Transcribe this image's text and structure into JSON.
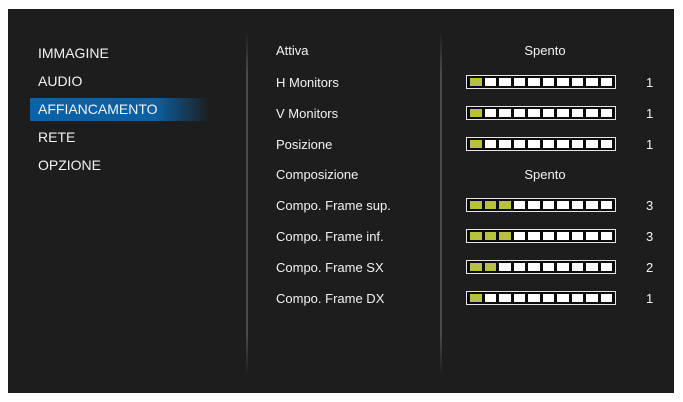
{
  "menu": {
    "items": [
      {
        "label": "IMMAGINE",
        "selected": false
      },
      {
        "label": "AUDIO",
        "selected": false
      },
      {
        "label": "AFFIANCAMENTO",
        "selected": true
      },
      {
        "label": "RETE",
        "selected": false
      },
      {
        "label": "OPZIONE",
        "selected": false
      }
    ]
  },
  "settings": {
    "rows": [
      {
        "label": "Attiva",
        "type": "text",
        "value": "Spento"
      },
      {
        "label": "H Monitors",
        "type": "slider",
        "value": "1",
        "level": 1,
        "segments": 10
      },
      {
        "label": "V Monitors",
        "type": "slider",
        "value": "1",
        "level": 1,
        "segments": 10
      },
      {
        "label": "Posizione",
        "type": "slider",
        "value": "1",
        "level": 1,
        "segments": 10
      },
      {
        "label": "Composizione",
        "type": "text",
        "value": "Spento"
      },
      {
        "label": "Compo. Frame sup.",
        "type": "slider",
        "value": "3",
        "level": 3,
        "segments": 10
      },
      {
        "label": "Compo. Frame inf.",
        "type": "slider",
        "value": "3",
        "level": 3,
        "segments": 10
      },
      {
        "label": "Compo. Frame SX",
        "type": "slider",
        "value": "2",
        "level": 2,
        "segments": 10
      },
      {
        "label": "Compo. Frame DX",
        "type": "slider",
        "value": "1",
        "level": 1,
        "segments": 10
      }
    ]
  },
  "colors": {
    "background": "#1d1d1d",
    "accent": "#0a62a8",
    "slider_fill": "#b6c13e",
    "slider_empty": "#ffffff",
    "text": "#f2f2f2"
  }
}
